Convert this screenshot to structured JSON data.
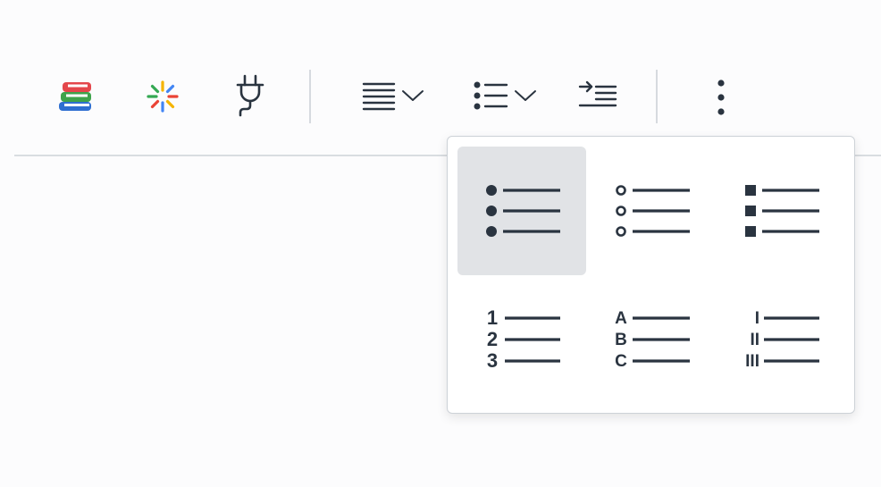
{
  "toolbar": {
    "buttons": [
      {
        "id": "book-stack",
        "icon": "book-stack-icon"
      },
      {
        "id": "sparkle",
        "icon": "sparkle-icon"
      },
      {
        "id": "plug",
        "icon": "plug-icon"
      },
      {
        "id": "align",
        "icon": "align-justify-icon",
        "has_dropdown": true
      },
      {
        "id": "bulleted-list",
        "icon": "bulleted-list-icon",
        "has_dropdown": true,
        "expanded": true
      },
      {
        "id": "indent",
        "icon": "indent-icon"
      },
      {
        "id": "more",
        "icon": "more-vertical-icon"
      }
    ]
  },
  "list_style_menu": {
    "options": [
      {
        "style": "disc",
        "icon": "disc-list-icon",
        "selected": true
      },
      {
        "style": "circle",
        "icon": "circle-list-icon",
        "selected": false
      },
      {
        "style": "square",
        "icon": "square-list-icon",
        "selected": false
      },
      {
        "style": "decimal",
        "icon": "decimal-list-icon",
        "markers": [
          "1",
          "2",
          "3"
        ],
        "selected": false
      },
      {
        "style": "upper-alpha",
        "icon": "upper-alpha-list-icon",
        "markers": [
          "A",
          "B",
          "C"
        ],
        "selected": false
      },
      {
        "style": "upper-roman",
        "icon": "upper-roman-list-icon",
        "markers": [
          "I",
          "II",
          "III"
        ],
        "selected": false
      }
    ]
  },
  "colors": {
    "icon": "#2a3440",
    "selected_bg": "#e1e3e6",
    "divider": "#d6dadf"
  }
}
